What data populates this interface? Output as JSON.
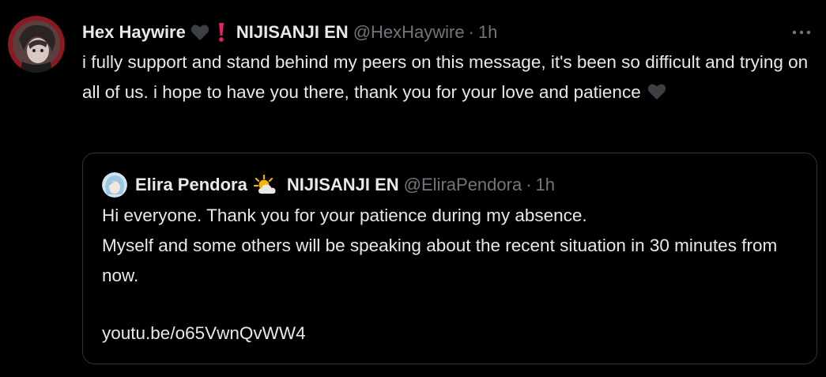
{
  "tweet": {
    "author_name": "Hex Haywire",
    "org": "NIJISANJI EN",
    "handle": "@HexHaywire",
    "separator": "·",
    "time": "1h",
    "text": "i fully support and stand behind my peers on this message, it's been so difficult and trying on all of us. i hope to have you there, thank you for your love and patience",
    "more_label": "···",
    "icons": {
      "name_badge": "black-heart-icon",
      "org_badge": "exclamation-icon",
      "text_emoji": "black-heart-icon",
      "more": "more-options-icon"
    }
  },
  "quoted_tweet": {
    "author_name": "Elira Pendora",
    "org": "NIJISANJI EN",
    "handle": "@EliraPendora",
    "separator": "·",
    "time": "1h",
    "lines": [
      "Hi everyone. Thank you for your patience during my absence.",
      "Myself and some others will be speaking about the recent situation in 30 minutes from now."
    ],
    "link": "youtu.be/o65VwnQvWW4",
    "icons": {
      "name_badge": "sun-behind-cloud-icon"
    }
  },
  "colors": {
    "background": "#000000",
    "primary_text": "#e7e9ea",
    "secondary_text": "#71767b",
    "border": "#2f3336",
    "alert_red": "#e0245e"
  }
}
